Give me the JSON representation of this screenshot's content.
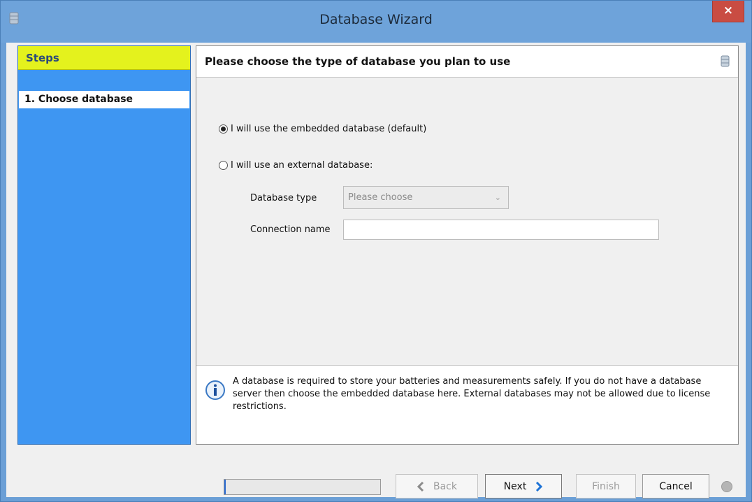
{
  "window": {
    "title": "Database Wizard",
    "close_label": "×"
  },
  "steps": {
    "header": "Steps",
    "items": [
      {
        "label": "1. Choose database"
      }
    ]
  },
  "main": {
    "title": "Please choose the type of database you plan to use",
    "options": [
      {
        "label": "I will use the embedded database (default)",
        "checked": true
      },
      {
        "label": "I will use an external database:",
        "checked": false
      }
    ],
    "database_type_label": "Database type",
    "database_type_value": "Please choose",
    "connection_name_label": "Connection name",
    "connection_name_value": "",
    "info_text": "A database is required to store your batteries and measurements safely. If you do not have a database server then choose the embedded database here. External databases may not be allowed due to license restrictions."
  },
  "footer": {
    "progress_fraction": 0.01,
    "back_label": "Back",
    "next_label": "Next",
    "finish_label": "Finish",
    "cancel_label": "Cancel"
  },
  "colors": {
    "steps_header_bg": "#e4f21d",
    "steps_bg": "#3e96f2",
    "close_button": "#c94c42",
    "accent_arrow": "#1e73d6"
  },
  "icons": [
    "database-icon",
    "close-icon",
    "info-icon",
    "chevron-left-icon",
    "chevron-right-icon",
    "chevron-down-icon",
    "status-icon"
  ]
}
